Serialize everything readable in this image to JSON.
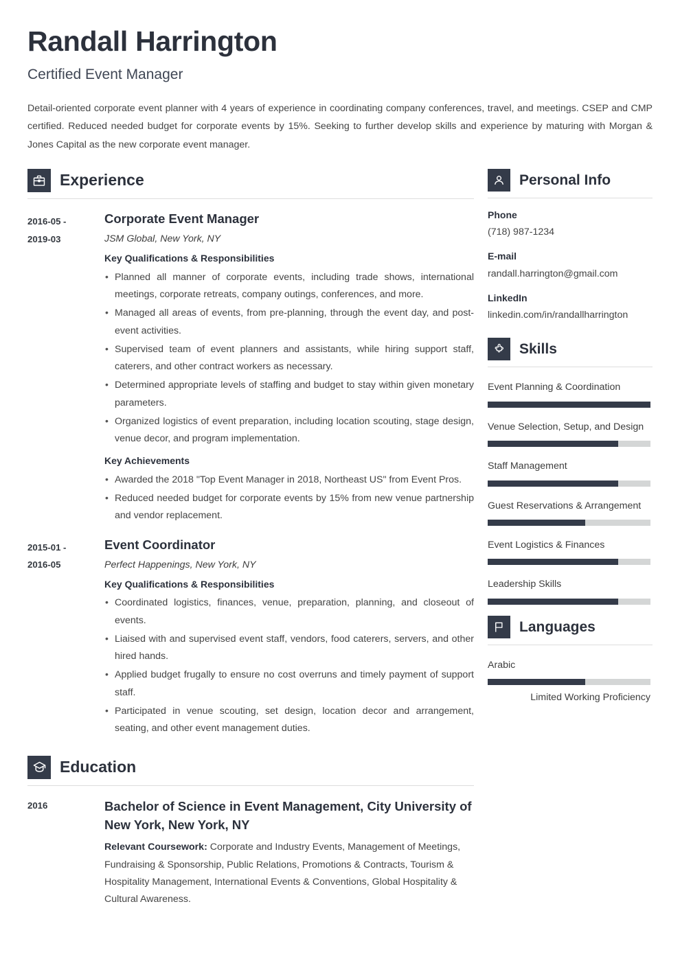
{
  "header": {
    "name": "Randall Harrington",
    "job_title": "Certified Event Manager",
    "summary": "Detail-oriented corporate event planner with 4 years of experience in coordinating company conferences, travel, and meetings. CSEP and CMP certified. Reduced needed budget for corporate events by 15%. Seeking to further develop skills and experience by maturing with Morgan & Jones Capital as the new corporate event manager."
  },
  "experience": {
    "title": "Experience",
    "icon": "briefcase-icon",
    "entries": [
      {
        "dates": "2016-05 - 2019-03",
        "date_line1": "2016-05 -",
        "date_line2": "2019-03",
        "title": "Corporate Event Manager",
        "company": "JSM Global, New York, NY",
        "qual_heading": "Key Qualifications & Responsibilities",
        "bullets": [
          "Planned all manner of corporate events, including trade shows, international meetings, corporate retreats, company outings, conferences, and more.",
          "Managed all areas of events, from pre-planning, through the event day, and post-event activities.",
          "Supervised team of event planners and assistants, while hiring support staff, caterers, and other contract workers as necessary.",
          "Determined appropriate levels of staffing and budget to stay within given monetary parameters.",
          "Organized logistics of event preparation, including location scouting, stage design, venue decor, and program implementation."
        ],
        "ach_heading": "Key Achievements",
        "achievements": [
          "Awarded the 2018 \"Top Event Manager in 2018, Northeast US\" from Event Pros.",
          "Reduced needed budget for corporate events by 15% from new venue partnership and vendor replacement."
        ]
      },
      {
        "dates": "2015-01 - 2016-05",
        "date_line1": "2015-01 -",
        "date_line2": "2016-05",
        "title": "Event Coordinator",
        "company": "Perfect Happenings, New York, NY",
        "qual_heading": "Key Qualifications & Responsibilities",
        "bullets": [
          "Coordinated logistics, finances, venue, preparation, planning, and closeout of events.",
          "Liaised with and supervised event staff, vendors, food caterers, servers, and other hired hands.",
          "Applied budget frugally to ensure no cost overruns and timely payment of support staff.",
          "Participated in venue scouting, set design, location decor and arrangement, seating, and other event management duties."
        ],
        "ach_heading": "",
        "achievements": []
      }
    ]
  },
  "education": {
    "title": "Education",
    "icon": "graduation-cap-icon",
    "entries": [
      {
        "date": "2016",
        "degree": "Bachelor of Science in Event Management, City University of New York, New York, NY",
        "coursework_label": "Relevant Coursework:",
        "coursework": " Corporate and Industry Events, Management of Meetings, Fundraising & Sponsorship, Public Relations, Promotions & Contracts, Tourism & Hospitality Management, International Events & Conventions, Global Hospitality & Cultural Awareness."
      }
    ]
  },
  "personal_info": {
    "title": "Personal Info",
    "icon": "person-icon",
    "items": [
      {
        "label": "Phone",
        "value": "(718) 987-1234"
      },
      {
        "label": "E-mail",
        "value": "randall.harrington@gmail.com"
      },
      {
        "label": "LinkedIn",
        "value": "linkedin.com/in/randallharrington"
      }
    ]
  },
  "skills": {
    "title": "Skills",
    "icon": "puzzle-piece-icon",
    "items": [
      {
        "name": "Event Planning & Coordination",
        "level": 100
      },
      {
        "name": "Venue Selection, Setup, and Design",
        "level": 80
      },
      {
        "name": "Staff Management",
        "level": 80
      },
      {
        "name": "Guest Reservations & Arrangement",
        "level": 60
      },
      {
        "name": "Event Logistics & Finances",
        "level": 80
      },
      {
        "name": "Leadership Skills",
        "level": 80
      }
    ]
  },
  "languages": {
    "title": "Languages",
    "icon": "flag-icon",
    "items": [
      {
        "name": "Arabic",
        "level": 60,
        "proficiency": "Limited Working Proficiency"
      }
    ]
  },
  "colors": {
    "accent_dark": "#343b49",
    "heading": "#2c313c",
    "bar_track": "#d4d6d6",
    "rule": "#dddddd"
  }
}
